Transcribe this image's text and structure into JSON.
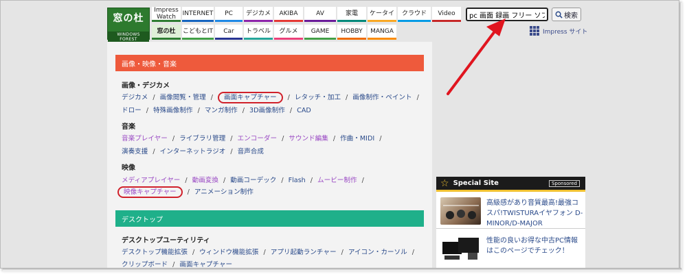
{
  "logo": {
    "jp": "窓の杜",
    "en": "WINDOWS FOREST"
  },
  "nav_row1": [
    "Impress Watch",
    "INTERNET",
    "PC",
    "デジカメ",
    "AKIBA",
    "AV",
    "家電",
    "ケータイ",
    "クラウド",
    "Video"
  ],
  "nav_row2": [
    "窓の杜",
    "こどもとIT",
    "Car",
    "トラベル",
    "グルメ",
    "GAME",
    "HOBBY",
    "MANGA"
  ],
  "search": {
    "value": "pc 画面 録画 フリー ソフト",
    "button": "検索"
  },
  "impress_site": "Impress サイト",
  "sections": [
    {
      "title": "画像・映像・音楽",
      "color": "#ee5a3c"
    },
    {
      "title": "デスクトップ",
      "color": "#1fb08a"
    }
  ],
  "groups": {
    "image": {
      "heading": "画像・デジカメ",
      "line1": [
        "デジカメ",
        "画像閲覧・管理",
        "画面キャプチャー",
        "レタッチ・加工",
        "画像制作・ペイント"
      ],
      "line2": [
        "ドロー",
        "特殊画像制作",
        "マンガ制作",
        "3D画像制作",
        "CAD"
      ]
    },
    "music": {
      "heading": "音楽",
      "line1": [
        "音楽プレイヤー",
        "ライブラリ管理",
        "エンコーダー",
        "サウンド編集",
        "作曲・MIDI"
      ],
      "line2": [
        "演奏支援",
        "インターネットラジオ",
        "音声合成"
      ]
    },
    "video": {
      "heading": "映像",
      "line1": [
        "メディアプレイヤー",
        "動画変換",
        "動画コーデック",
        "Flash",
        "ムービー制作"
      ],
      "line2": [
        "映像キャプチャー",
        "アニメーション制作"
      ]
    },
    "desktop": {
      "heading": "デスクトップユーティリティ",
      "line1": [
        "デスクトップ機能拡張",
        "ウィンドウ機能拡張",
        "アプリ起動ランチャー",
        "アイコン・カーソル"
      ],
      "line2": [
        "クリップボード",
        "画面キャプチャー"
      ]
    }
  },
  "special_site": {
    "title": "Special Site",
    "sponsored": "Sponsored",
    "items": [
      {
        "text": "高級感があり音質最高!最強コスパ!TWISTURAイヤフォン D-MINOR/D-MAJOR"
      },
      {
        "text": "性能の良いお得な中古PC情報はこのページでチェック！"
      }
    ]
  },
  "colors": {
    "link": "#2a4a8a",
    "visited": "#9a49c4",
    "highlight_circle": "#d0202a",
    "arrow": "#e0151f"
  }
}
